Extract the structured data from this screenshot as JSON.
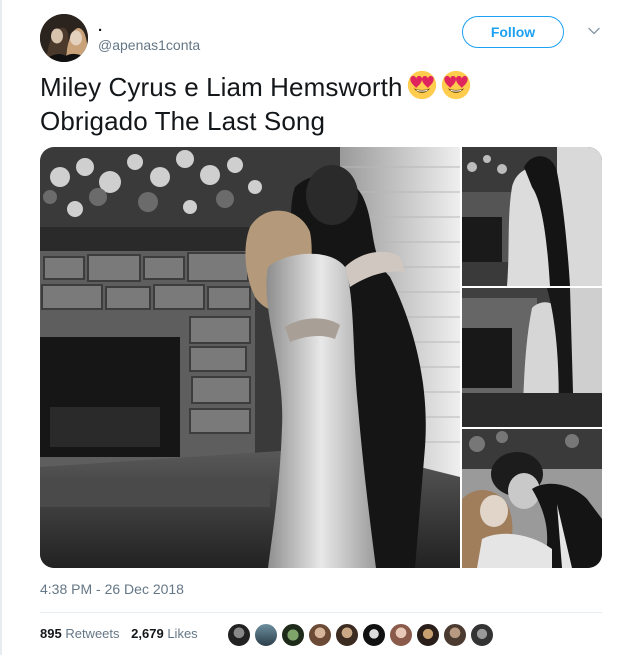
{
  "tweet": {
    "display_name": ".",
    "handle": "@apenas1conta",
    "follow_label": "Follow",
    "text_line1": "Miley Cyrus e Liam Hemsworth",
    "text_line2": "Obrigado The Last Song",
    "emojis": [
      "heart-eyes-emoji",
      "heart-eyes-emoji"
    ],
    "timestamp": "4:38 PM - 26 Dec 2018",
    "retweets_count": "895",
    "retweets_label": "Retweets",
    "likes_count": "2,679",
    "likes_label": "Likes",
    "liker_avatar_count": 10
  },
  "colors": {
    "accent": "#1da1f2",
    "muted": "#657786",
    "text": "#14171a",
    "divider": "#e6ecf0",
    "emoji_face": "#ffcc4d",
    "emoji_heart": "#e0245e"
  },
  "icons": {
    "caret": "chevron-down-icon"
  }
}
